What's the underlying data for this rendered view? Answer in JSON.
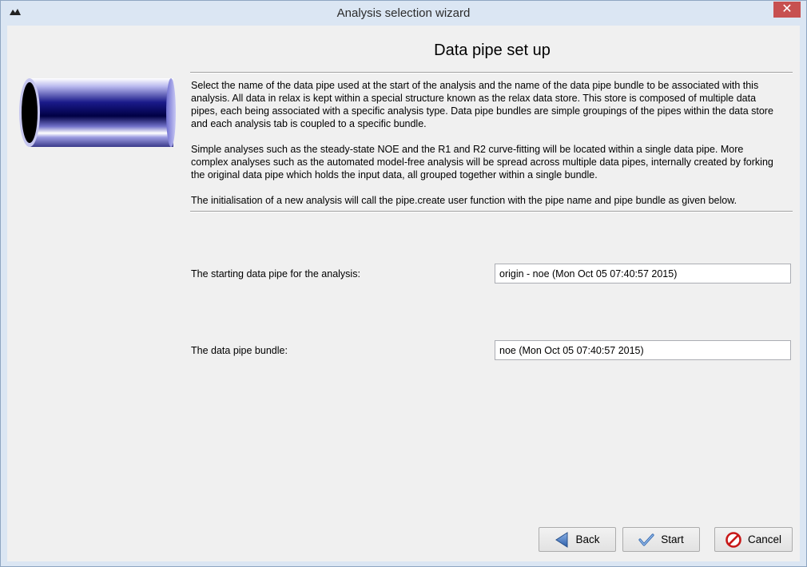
{
  "window": {
    "title": "Analysis selection wizard",
    "close_glyph": "✕"
  },
  "page": {
    "heading": "Data pipe set up",
    "paragraphs": [
      "Select the name of the data pipe used at the start of the analysis and the name of the data pipe bundle to be associated with this analysis.  All data in relax is kept within a special structure known as the relax data store.  This store is composed of multiple data pipes, each being associated with a specific analysis type.  Data pipe bundles are simple groupings of the pipes within the data store and each analysis tab is coupled to a specific bundle.",
      "Simple analyses such as the steady-state NOE and the R1 and R2 curve-fitting will be located within a single data pipe.  More complex analyses such as the automated model-free analysis will be spread across multiple data pipes, internally created by forking the original data pipe which holds the input data, all grouped together within a single bundle.",
      "The initialisation of a new analysis will call the pipe.create user function with the pipe name and pipe bundle as given below."
    ]
  },
  "form": {
    "pipe_label": "The starting data pipe for the analysis:",
    "pipe_value": "origin - noe (Mon Oct 05 07:40:57 2015)",
    "bundle_label": "The data pipe bundle:",
    "bundle_value": "noe (Mon Oct 05 07:40:57 2015)"
  },
  "buttons": {
    "back": "Back",
    "start": "Start",
    "cancel": "Cancel"
  },
  "icons": {
    "app": "relax-logo-icon",
    "side_image": "data-pipe-image",
    "back": "left-arrow-icon",
    "start": "checkmark-icon",
    "cancel": "cancel-icon"
  }
}
